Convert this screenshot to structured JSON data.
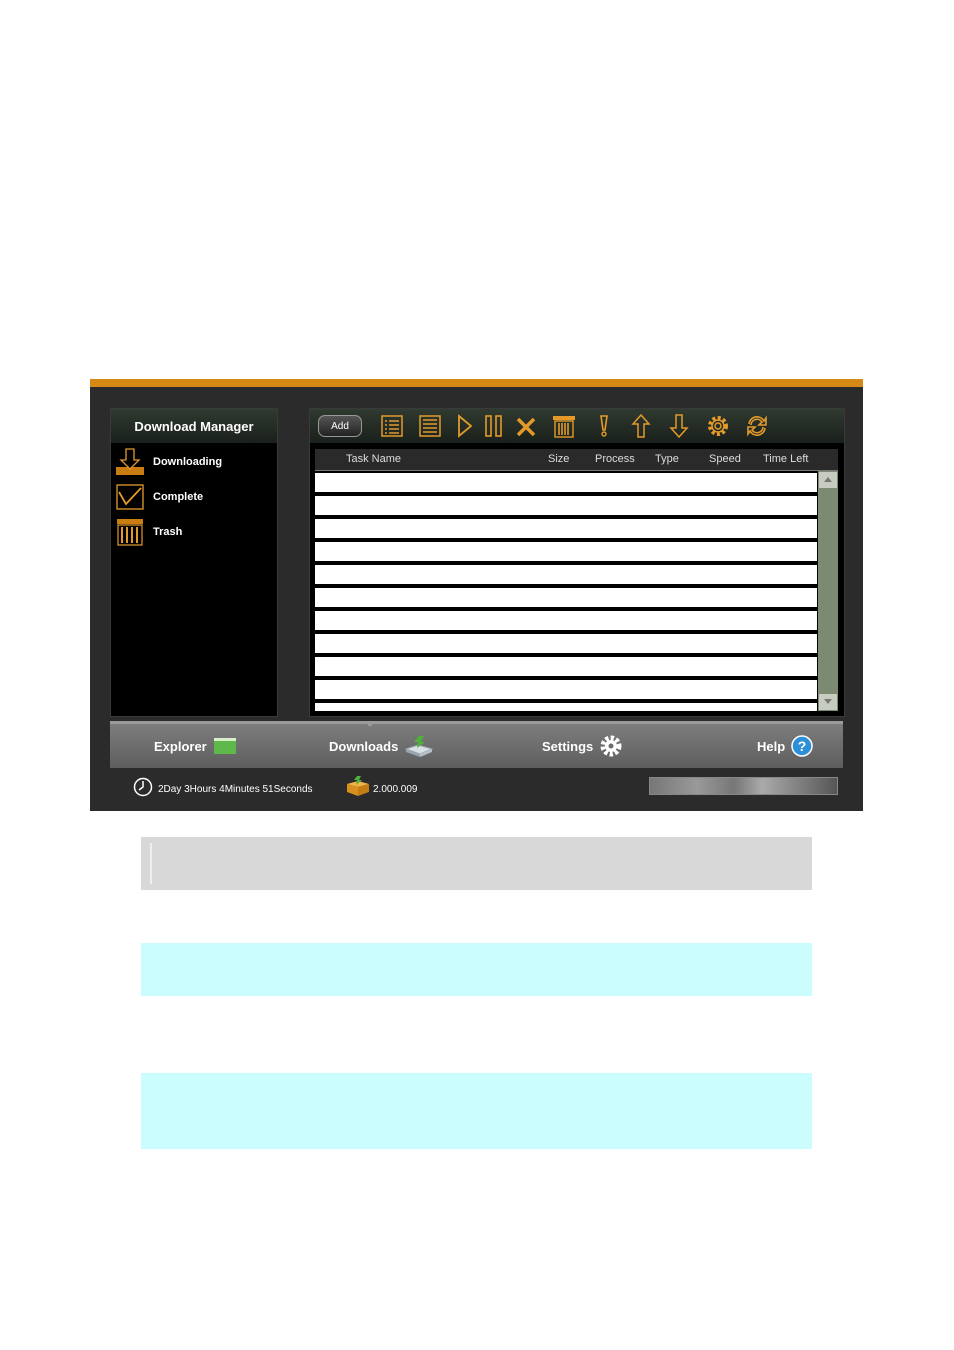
{
  "sidebar": {
    "title": "Download Manager",
    "items": [
      {
        "label": "Downloading",
        "icon": "downloading-icon"
      },
      {
        "label": "Complete",
        "icon": "complete-icon"
      },
      {
        "label": "Trash",
        "icon": "trash-icon"
      }
    ]
  },
  "toolbar": {
    "add_label": "Add",
    "icons": [
      "task-list-icon",
      "task-detail-icon",
      "start-icon",
      "pause-icon",
      "delete-icon",
      "trash-icon",
      "priority-icon",
      "move-up-icon",
      "move-down-icon",
      "settings-icon",
      "refresh-icon"
    ],
    "accent": "#d58a16"
  },
  "table": {
    "columns": [
      "Task Name",
      "Size",
      "Process",
      "Type",
      "Speed",
      "Time Left"
    ],
    "rows": []
  },
  "nav": {
    "items": [
      {
        "label": "Explorer",
        "icon": "folder-icon"
      },
      {
        "label": "Downloads",
        "icon": "downloads-icon"
      },
      {
        "label": "Settings",
        "icon": "gear-icon"
      },
      {
        "label": "Help",
        "icon": "help-icon"
      }
    ]
  },
  "status": {
    "uptime": "2Day 3Hours 4Minutes 51Seconds",
    "version": "2.000.009"
  }
}
